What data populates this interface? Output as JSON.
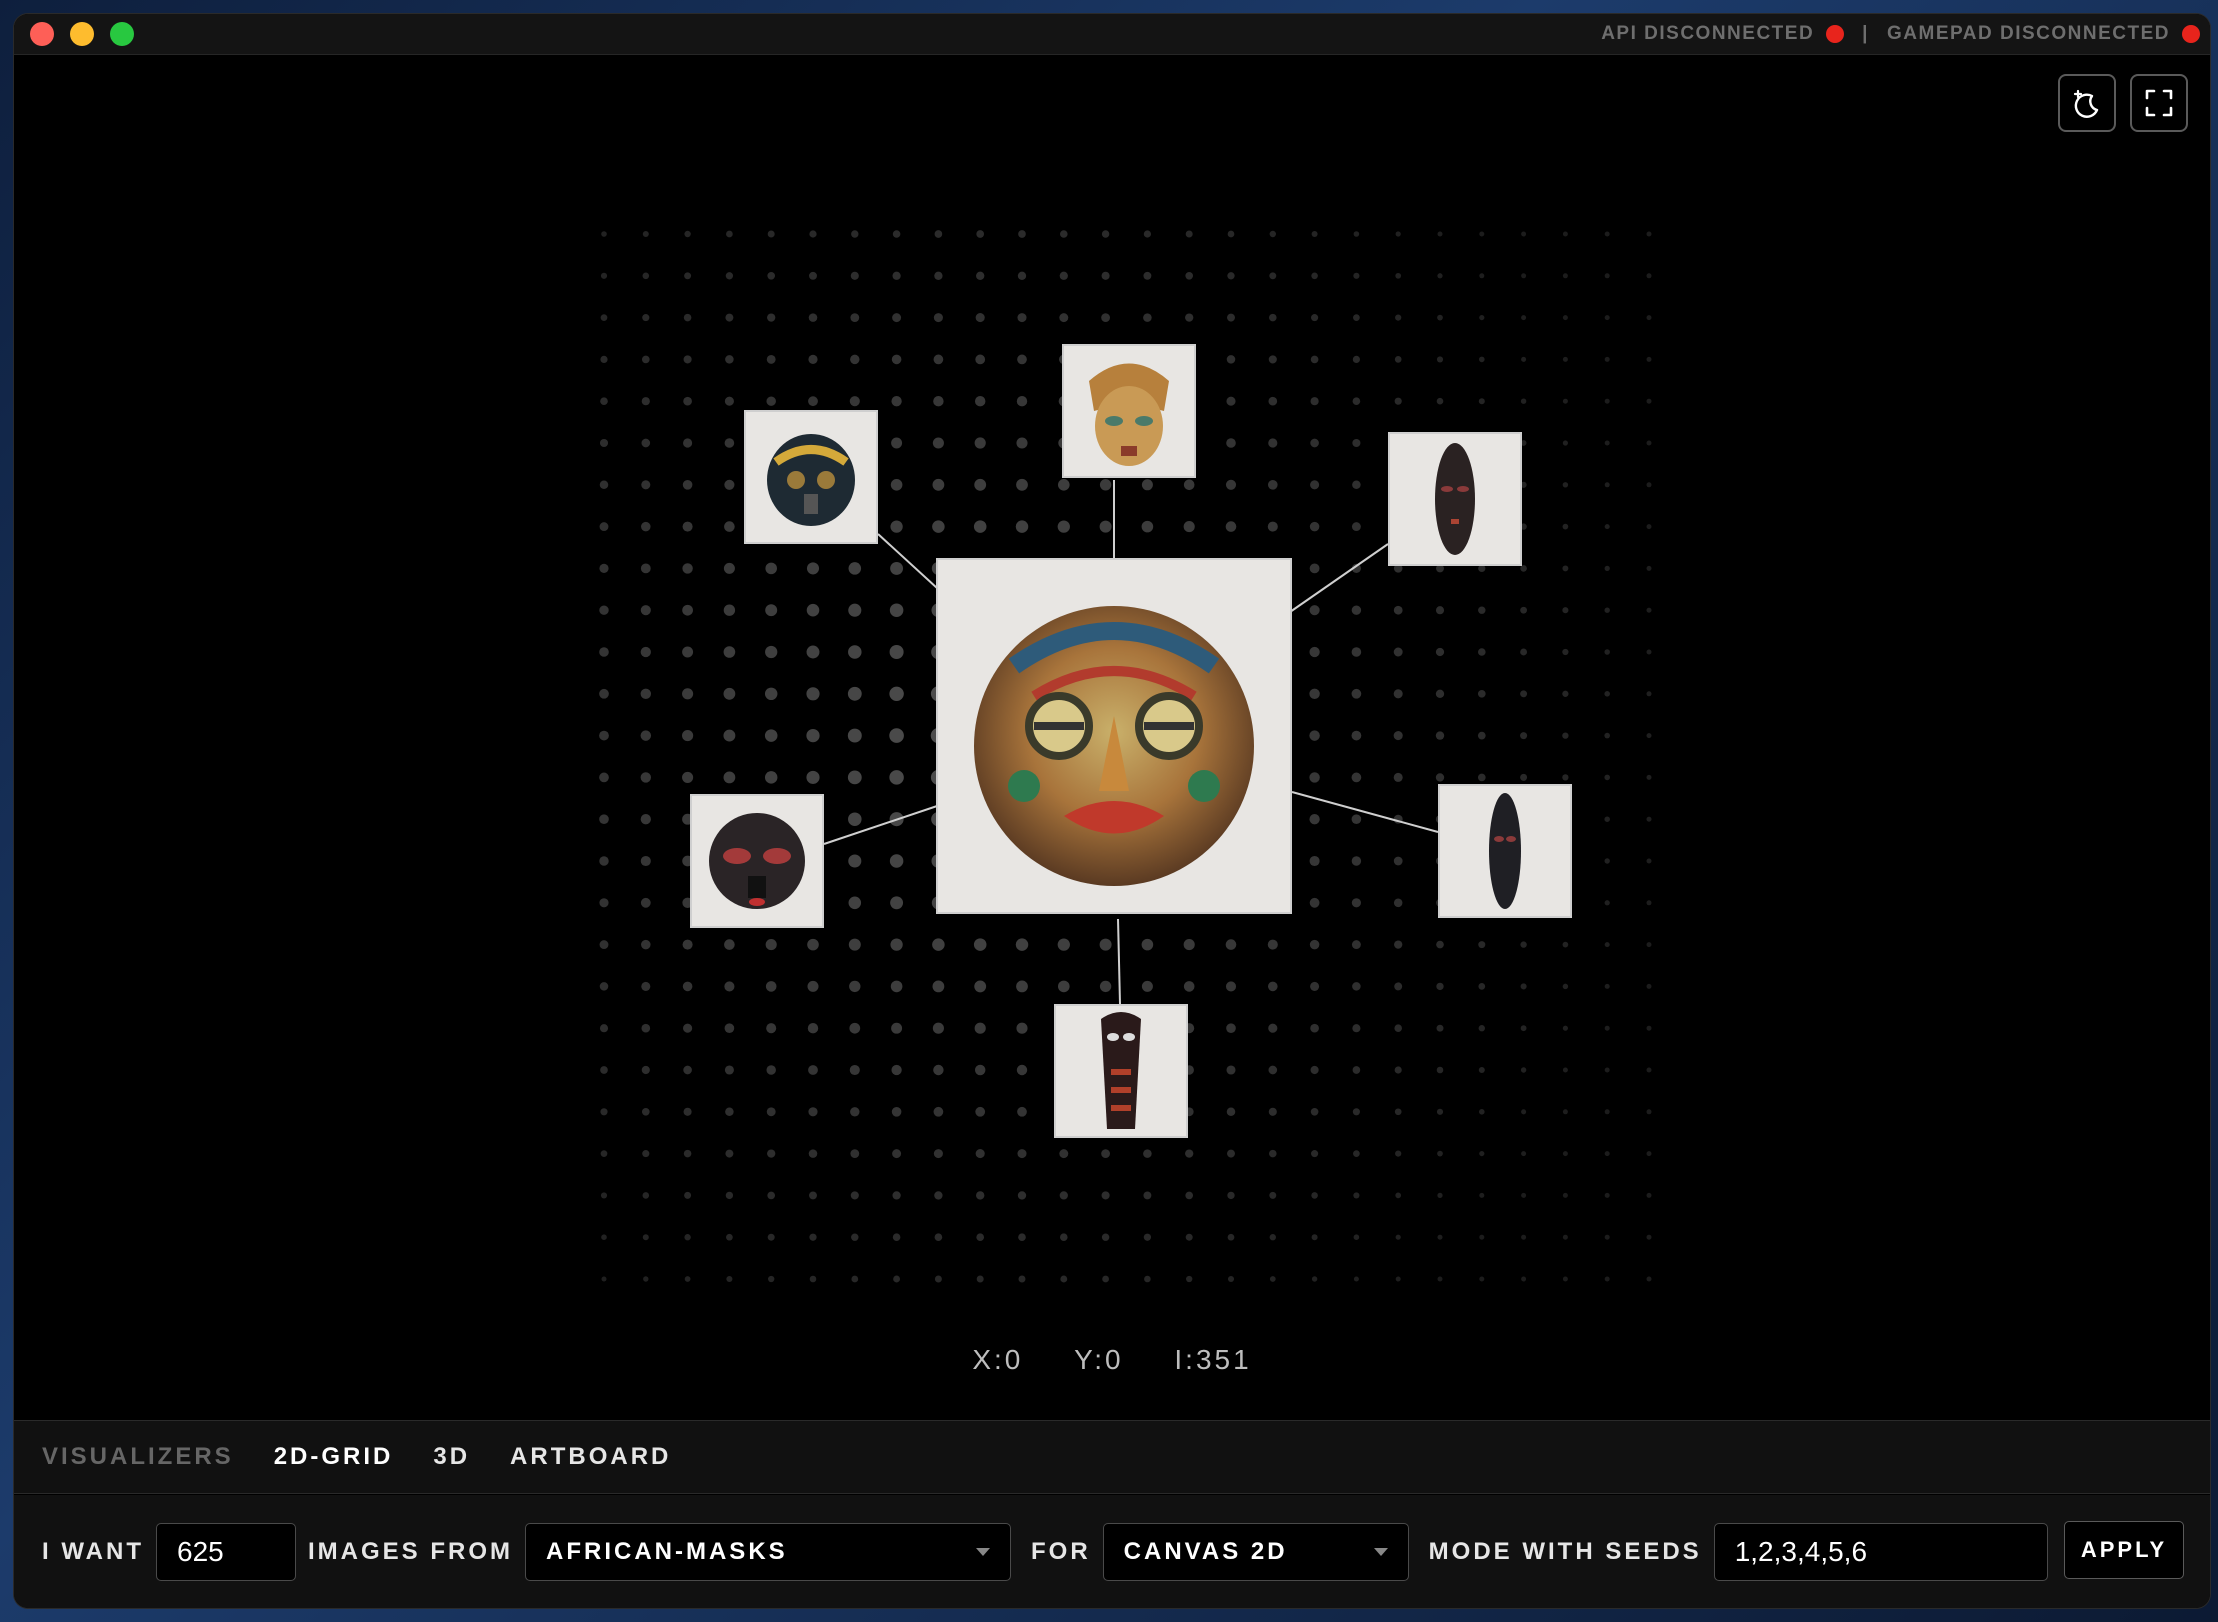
{
  "titlebar": {
    "api_status": "API DISCONNECTED",
    "separator": "|",
    "gamepad_status": "GAMEPAD DISCONNECTED",
    "status_color": "#e8241c"
  },
  "toolbar": {
    "theme_icon": "moon-sparkle-icon",
    "fullscreen_icon": "fullscreen-icon"
  },
  "canvas": {
    "x_label": "X:0",
    "y_label": "Y:0",
    "i_label": "I:351"
  },
  "visualizers": {
    "label": "VISUALIZERS",
    "tabs": [
      "2D-GRID",
      "3D",
      "ARTBOARD"
    ],
    "active": "2D-GRID"
  },
  "controls": {
    "i_want_label": "I WANT",
    "count_value": "625",
    "images_from_label": "IMAGES FROM",
    "dataset_value": "AFRICAN-MASKS",
    "for_label": "FOR",
    "renderer_value": "CANVAS 2D",
    "mode_seeds_label": "MODE WITH SEEDS",
    "seeds_value": "1,2,3,4,5,6",
    "apply_label": "APPLY"
  }
}
